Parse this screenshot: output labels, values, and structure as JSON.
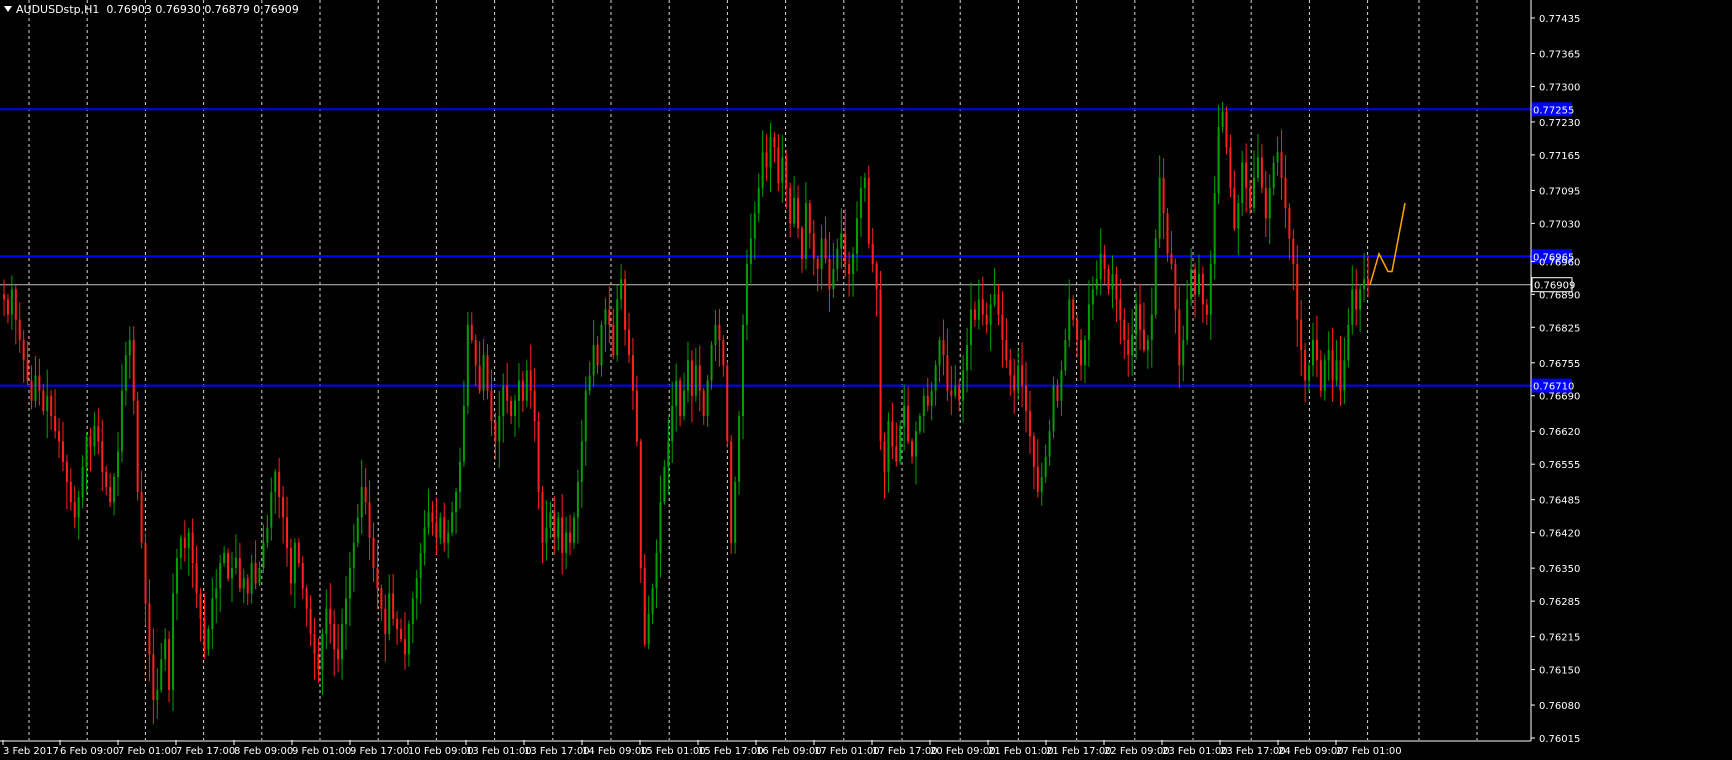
{
  "window": {
    "symbol_label": "AUDUSDstp,H1",
    "ohlc": "0.76903 0.76930 0.76879 0.76909"
  },
  "colors": {
    "background": "#000000",
    "bull": "#00a000",
    "bear": "#ff2020",
    "grid": "#ffffff",
    "hline": "#0000ff",
    "forecast": "#ffa500",
    "axis_text": "#ffffff"
  },
  "chart_data": {
    "type": "candlestick",
    "timeframe": "H1",
    "ylim": [
      0.76015,
      0.7745
    ],
    "y_ticks": [
      0.77435,
      0.77365,
      0.773,
      0.7723,
      0.77165,
      0.77095,
      0.7703,
      0.76955,
      0.7689,
      0.76825,
      0.76755,
      0.7669,
      0.7662,
      0.76555,
      0.76485,
      0.7642,
      0.7635,
      0.76285,
      0.76215,
      0.7615,
      0.7608,
      0.76015
    ],
    "y_tick_labels": [
      "0.77435",
      "0.77365",
      "0.77300",
      "0.77230",
      "0.77165",
      "0.77095",
      "0.77030",
      "0.76960",
      "0.76890",
      "0.76825",
      "0.76755",
      "0.76690",
      "0.76620",
      "0.76555",
      "0.76485",
      "0.76420",
      "0.76350",
      "0.76285",
      "0.76215",
      "0.76150",
      "0.76080",
      "0.76015"
    ],
    "x_labels": [
      "3 Feb 2017",
      "6 Feb 09:00",
      "7 Feb 01:00",
      "7 Feb 17:00",
      "8 Feb 09:00",
      "9 Feb 01:00",
      "9 Feb 17:00",
      "10 Feb 09:00",
      "13 Feb 01:00",
      "13 Feb 17:00",
      "14 Feb 09:00",
      "15 Feb 01:00",
      "15 Feb 17:00",
      "16 Feb 09:00",
      "17 Feb 01:00",
      "17 Feb 17:00",
      "20 Feb 09:00",
      "21 Feb 01:00",
      "21 Feb 17:00",
      "22 Feb 09:00",
      "23 Feb 01:00",
      "23 Feb 17:00",
      "24 Feb 09:00",
      "27 Feb 01:00"
    ],
    "horizontal_levels": [
      {
        "value": 0.77255,
        "label": "0.77255"
      },
      {
        "value": 0.76965,
        "label": "0.76965"
      },
      {
        "value": 0.7671,
        "label": "0.76710"
      }
    ],
    "current_price": {
      "value": 0.76909,
      "label": "0.76909"
    },
    "closes": [
      0.7688,
      0.7685,
      0.769,
      0.7684,
      0.768,
      0.7676,
      0.7672,
      0.7668,
      0.7673,
      0.767,
      0.7666,
      0.7669,
      0.7665,
      0.7662,
      0.766,
      0.7656,
      0.7652,
      0.7648,
      0.7645,
      0.7649,
      0.7655,
      0.7661,
      0.7659,
      0.7663,
      0.766,
      0.7654,
      0.7651,
      0.7648,
      0.7653,
      0.7658,
      0.767,
      0.7677,
      0.768,
      0.7668,
      0.765,
      0.764,
      0.7628,
      0.7618,
      0.7609,
      0.7611,
      0.7617,
      0.7621,
      0.7611,
      0.763,
      0.7637,
      0.7641,
      0.7639,
      0.7642,
      0.7636,
      0.763,
      0.7625,
      0.7619,
      0.7623,
      0.7629,
      0.7631,
      0.7636,
      0.7638,
      0.7633,
      0.7635,
      0.7637,
      0.7631,
      0.7633,
      0.763,
      0.7636,
      0.7632,
      0.7635,
      0.764,
      0.7643,
      0.765,
      0.7654,
      0.7649,
      0.7645,
      0.7639,
      0.7632,
      0.764,
      0.7636,
      0.7631,
      0.7627,
      0.7622,
      0.7618,
      0.7615,
      0.7622,
      0.7627,
      0.7624,
      0.7619,
      0.7617,
      0.7624,
      0.7629,
      0.7635,
      0.764,
      0.7645,
      0.7651,
      0.7648,
      0.7641,
      0.7635,
      0.7631,
      0.7627,
      0.7622,
      0.763,
      0.7625,
      0.7623,
      0.7621,
      0.7618,
      0.7624,
      0.7629,
      0.7633,
      0.7638,
      0.7643,
      0.7646,
      0.7644,
      0.7641,
      0.7645,
      0.764,
      0.7642,
      0.7646,
      0.765,
      0.7656,
      0.7667,
      0.7683,
      0.768,
      0.7675,
      0.767,
      0.7677,
      0.767,
      0.7664,
      0.766,
      0.7665,
      0.7671,
      0.7668,
      0.7665,
      0.7668,
      0.7672,
      0.7668,
      0.7674,
      0.767,
      0.7664,
      0.765,
      0.764,
      0.7643,
      0.7646,
      0.7641,
      0.7645,
      0.7638,
      0.7642,
      0.764,
      0.7645,
      0.7652,
      0.766,
      0.767,
      0.7673,
      0.7679,
      0.7675,
      0.7683,
      0.7686,
      0.7683,
      0.7677,
      0.7688,
      0.7692,
      0.7682,
      0.7677,
      0.767,
      0.766,
      0.7635,
      0.762,
      0.7626,
      0.7631,
      0.7638,
      0.7648,
      0.7655,
      0.766,
      0.7667,
      0.7672,
      0.7665,
      0.767,
      0.7676,
      0.7669,
      0.7675,
      0.767,
      0.7665,
      0.7672,
      0.7679,
      0.7683,
      0.768,
      0.7675,
      0.766,
      0.764,
      0.7652,
      0.7665,
      0.7683,
      0.7695,
      0.77,
      0.7705,
      0.771,
      0.7717,
      0.7714,
      0.772,
      0.7718,
      0.7711,
      0.7716,
      0.771,
      0.7703,
      0.7708,
      0.7702,
      0.7696,
      0.7707,
      0.7701,
      0.7696,
      0.7694,
      0.77,
      0.7696,
      0.769,
      0.7694,
      0.7698,
      0.7701,
      0.7695,
      0.7693,
      0.7697,
      0.7704,
      0.771,
      0.7712,
      0.7699,
      0.7695,
      0.769,
      0.766,
      0.7654,
      0.7664,
      0.7659,
      0.7656,
      0.7663,
      0.7667,
      0.766,
      0.7657,
      0.7662,
      0.7665,
      0.7669,
      0.7667,
      0.767,
      0.7675,
      0.768,
      0.7677,
      0.767,
      0.7669,
      0.7671,
      0.7668,
      0.7674,
      0.7679,
      0.7686,
      0.7684,
      0.7688,
      0.7685,
      0.7683,
      0.7687,
      0.7689,
      0.7685,
      0.768,
      0.7676,
      0.7673,
      0.767,
      0.7675,
      0.7671,
      0.7666,
      0.7661,
      0.7655,
      0.765,
      0.7653,
      0.7657,
      0.7662,
      0.7671,
      0.7668,
      0.7674,
      0.768,
      0.7688,
      0.7684,
      0.768,
      0.7675,
      0.768,
      0.7687,
      0.769,
      0.7692,
      0.7697,
      0.7694,
      0.769,
      0.7693,
      0.7688,
      0.7684,
      0.768,
      0.7677,
      0.7681,
      0.7687,
      0.7682,
      0.7678,
      0.768,
      0.7685,
      0.77,
      0.7712,
      0.7705,
      0.7697,
      0.7695,
      0.7686,
      0.7675,
      0.768,
      0.7688,
      0.7694,
      0.7689,
      0.7693,
      0.7687,
      0.7685,
      0.7695,
      0.7709,
      0.7722,
      0.7725,
      0.7718,
      0.771,
      0.7702,
      0.7707,
      0.7715,
      0.771,
      0.7706,
      0.7712,
      0.7716,
      0.771,
      0.7704,
      0.771,
      0.7715,
      0.7717,
      0.7712,
      0.7706,
      0.77,
      0.7695,
      0.7684,
      0.7678,
      0.7672,
      0.7675,
      0.768,
      0.7676,
      0.767,
      0.7676,
      0.7678,
      0.7672,
      0.7676,
      0.767,
      0.7676,
      0.7683,
      0.769,
      0.7686,
      0.769,
      0.7692,
      0.7691
    ]
  },
  "forecast": {
    "points": [
      0.76909,
      0.7697,
      0.76935,
      0.77005,
      0.7707
    ]
  }
}
